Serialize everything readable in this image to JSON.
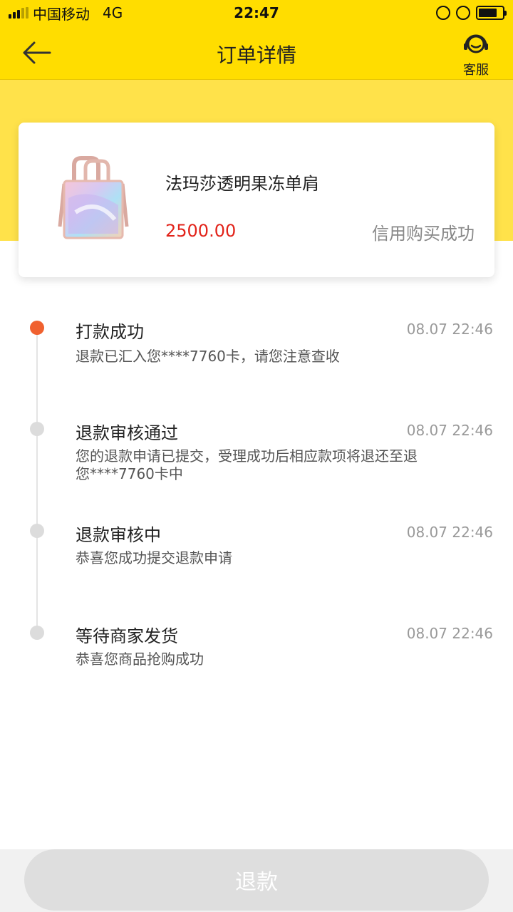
{
  "status_bar": {
    "carrier": "中国移动",
    "network": "4G",
    "time": "22:47"
  },
  "nav": {
    "title": "订单详情",
    "service_label": "客服"
  },
  "product": {
    "name": "法玛莎透明果冻单肩",
    "price": "2500.00",
    "status": "信用购买成功",
    "image_icon": "bag-image"
  },
  "timeline": [
    {
      "title": "打款成功",
      "time": "08.07 22:46",
      "desc": "退款已汇入您****7760卡，请您注意查收",
      "active": true
    },
    {
      "title": "退款审核通过",
      "time": "08.07 22:46",
      "desc": "您的退款申请已提交，受理成功后相应款项将退还至退您****7760卡中",
      "active": false
    },
    {
      "title": "退款审核中",
      "time": "08.07 22:46",
      "desc": "恭喜您成功提交退款申请",
      "active": false
    },
    {
      "title": "等待商家发货",
      "time": "08.07 22:46",
      "desc": "恭喜您商品抢购成功",
      "active": false
    }
  ],
  "bottom": {
    "refund_label": "退款"
  },
  "colors": {
    "brand_yellow": "#ffdd00",
    "active_dot": "#f0612f",
    "price_red": "#e2231a"
  }
}
